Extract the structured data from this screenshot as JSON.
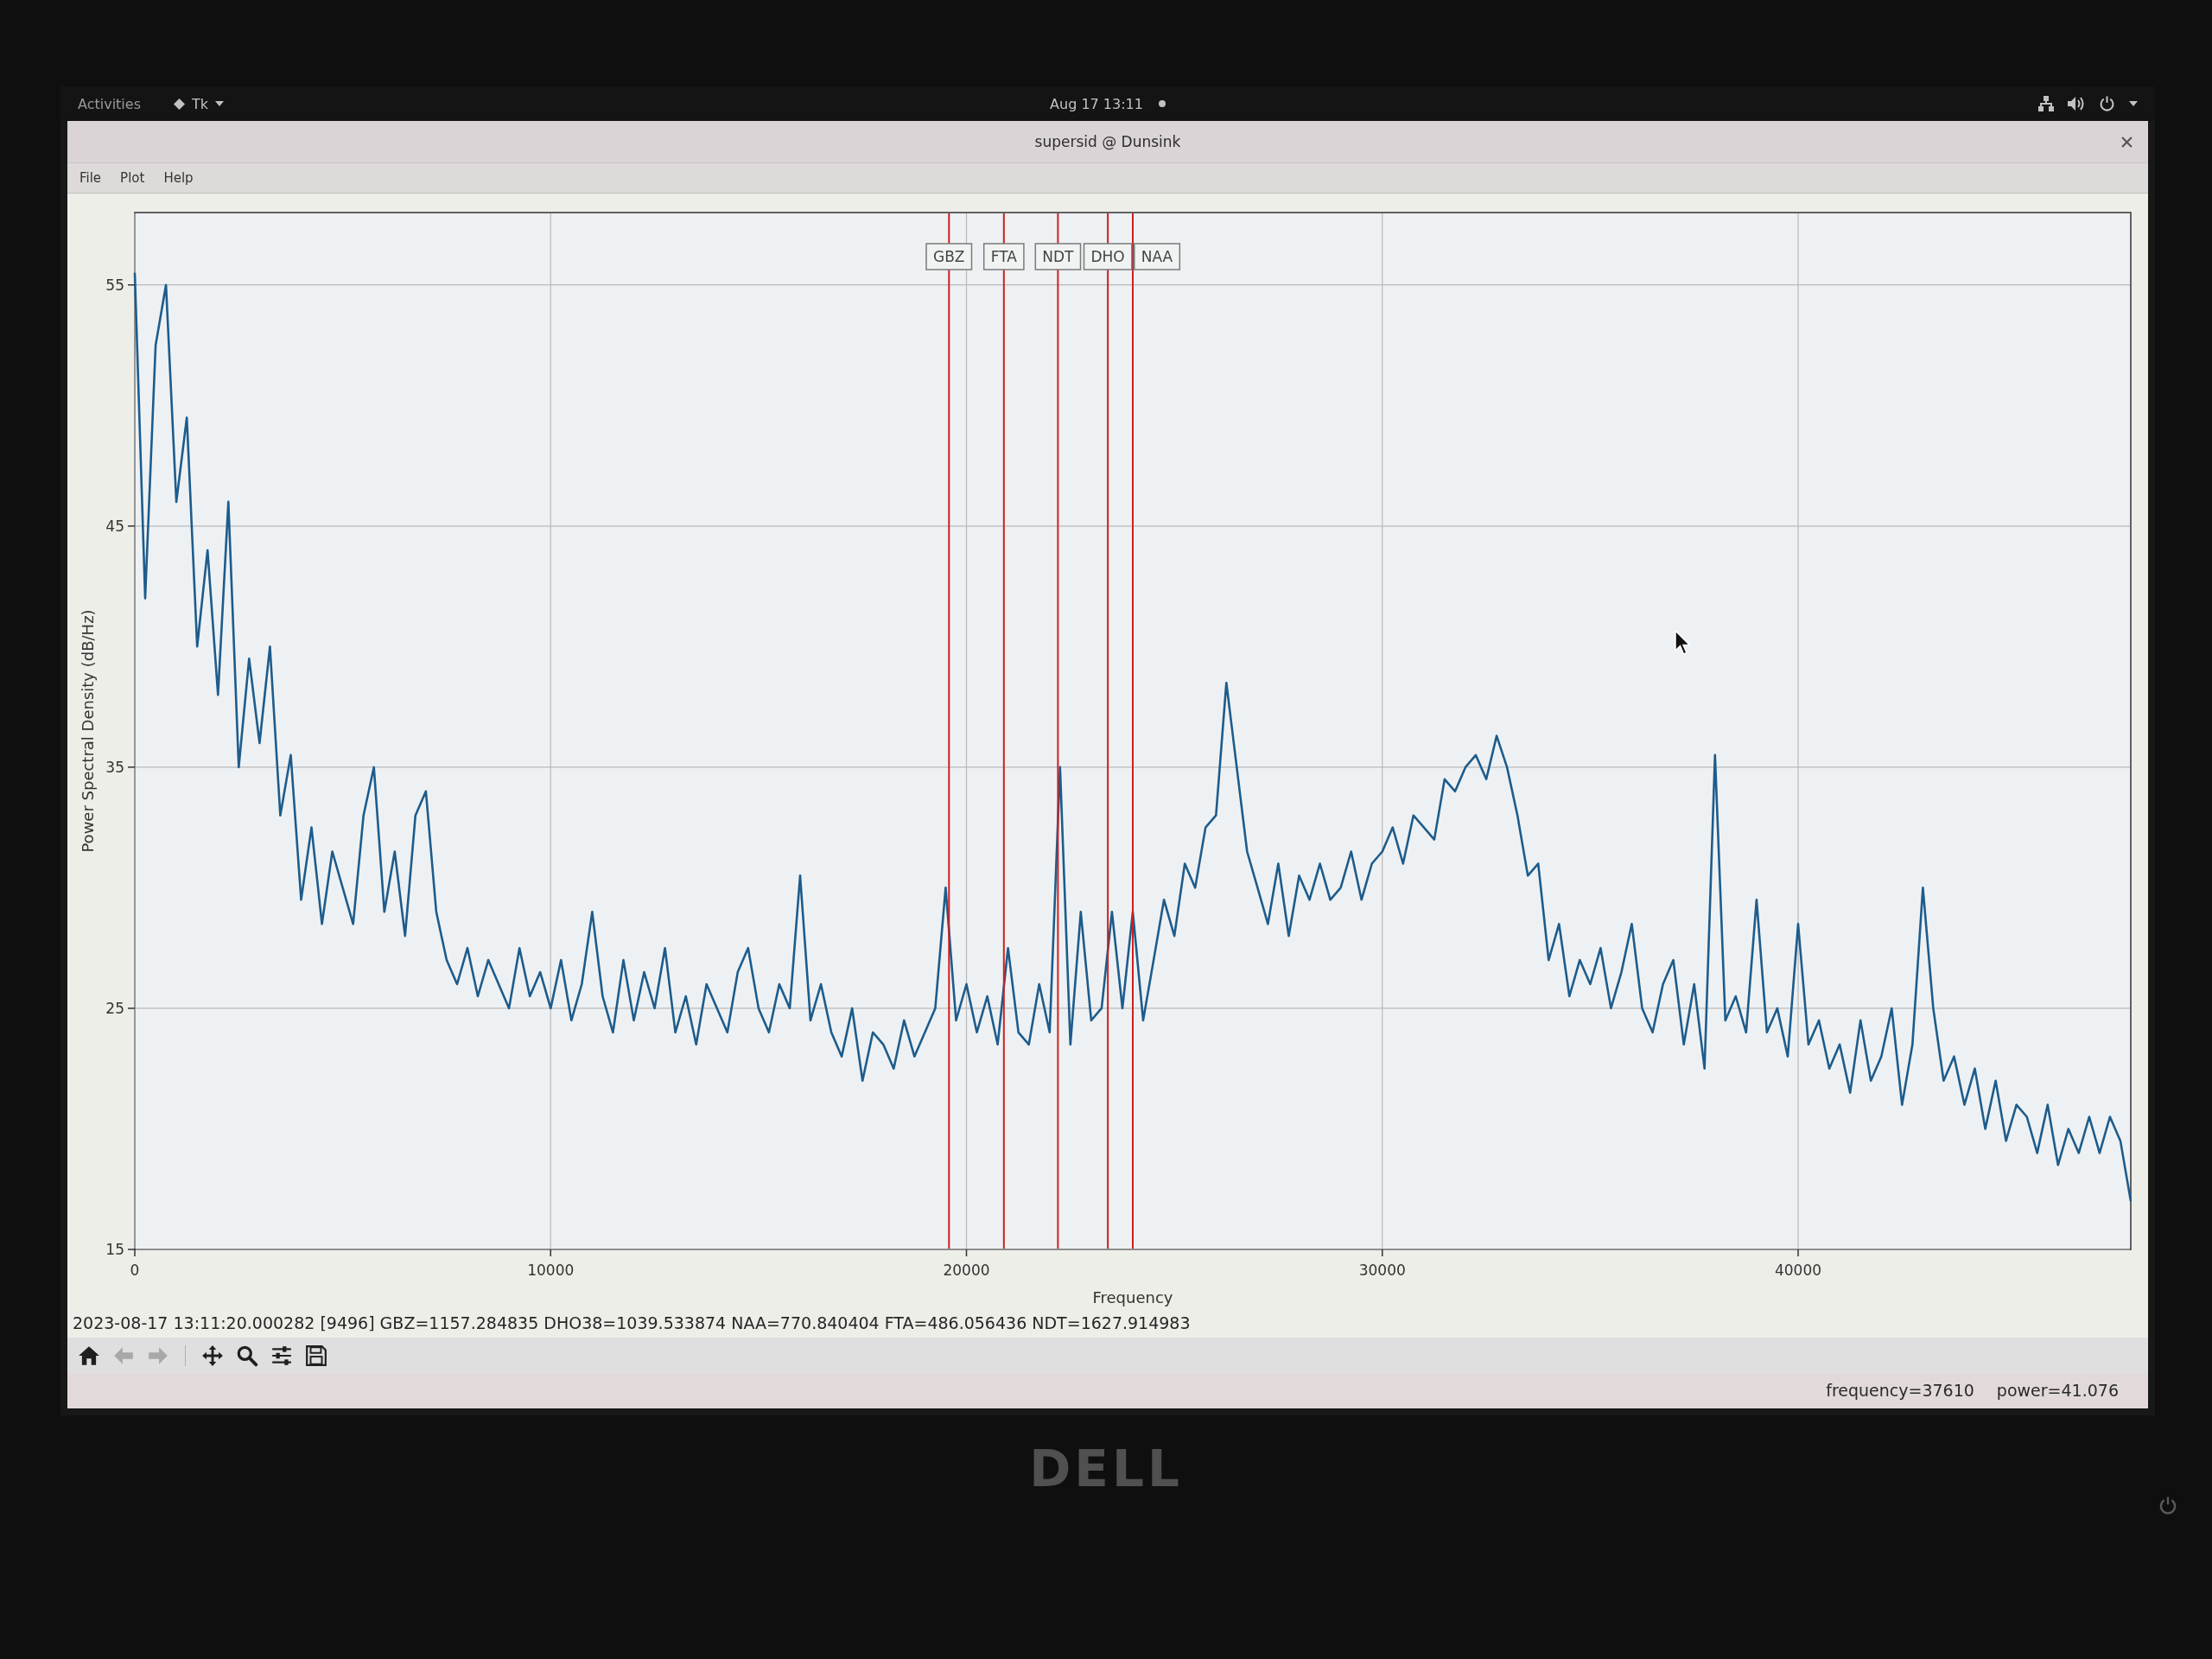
{
  "top_bar": {
    "activities": "Activities",
    "app_menu": "Tk",
    "clock": "Aug 17 13:11"
  },
  "window": {
    "title": "supersid @ Dunsink"
  },
  "menu": [
    "File",
    "Plot",
    "Help"
  ],
  "plot": {
    "chart_data": {
      "type": "line",
      "xlabel": "Frequency",
      "ylabel": "Power Spectral Density (dB/Hz)",
      "x": [
        0,
        250,
        500,
        750,
        1000,
        1250,
        1500,
        1750,
        2000,
        2250,
        2500,
        2750,
        3000,
        3250,
        3500,
        3750,
        4000,
        4250,
        4500,
        4750,
        5000,
        5250,
        5500,
        5750,
        6000,
        6250,
        6500,
        6750,
        7000,
        7250,
        7500,
        7750,
        8000,
        8250,
        8500,
        8750,
        9000,
        9250,
        9500,
        9750,
        10000,
        10250,
        10500,
        10750,
        11000,
        11250,
        11500,
        11750,
        12000,
        12250,
        12500,
        12750,
        13000,
        13250,
        13500,
        13750,
        14000,
        14250,
        14500,
        14750,
        15000,
        15250,
        15500,
        15750,
        16000,
        16250,
        16500,
        16750,
        17000,
        17250,
        17500,
        17750,
        18000,
        18250,
        18500,
        18750,
        19000,
        19250,
        19500,
        19750,
        20000,
        20250,
        20500,
        20750,
        21000,
        21250,
        21500,
        21750,
        22000,
        22250,
        22500,
        22750,
        23000,
        23250,
        23500,
        23750,
        24000,
        24250,
        24500,
        24750,
        25000,
        25250,
        25500,
        25750,
        26000,
        26250,
        26500,
        26750,
        27000,
        27250,
        27500,
        27750,
        28000,
        28250,
        28500,
        28750,
        29000,
        29250,
        29500,
        29750,
        30000,
        30250,
        30500,
        30750,
        31000,
        31250,
        31500,
        31750,
        32000,
        32250,
        32500,
        32750,
        33000,
        33250,
        33500,
        33750,
        34000,
        34250,
        34500,
        34750,
        35000,
        35250,
        35500,
        35750,
        36000,
        36250,
        36500,
        36750,
        37000,
        37250,
        37500,
        37750,
        38000,
        38250,
        38500,
        38750,
        39000,
        39250,
        39500,
        39750,
        40000,
        40250,
        40500,
        40750,
        41000,
        41250,
        41500,
        41750,
        42000,
        42250,
        42500,
        42750,
        43000,
        43250,
        43500,
        43750,
        44000,
        44250,
        44500,
        44750,
        45000,
        45250,
        45500,
        45750,
        46000,
        46250,
        46500,
        46750,
        47000,
        47250,
        47500,
        47750,
        48000
      ],
      "series": [
        {
          "color": "#1d5c8c",
          "values": [
            55.5,
            42,
            52.5,
            55,
            46,
            49.5,
            40,
            44,
            38,
            46,
            35,
            39.5,
            36,
            40,
            33,
            35.5,
            29.5,
            32.5,
            28.5,
            31.5,
            30,
            28.5,
            33,
            35,
            29,
            31.5,
            28,
            33,
            34,
            29,
            27,
            26,
            27.5,
            25.5,
            27,
            26,
            25,
            27.5,
            25.5,
            26.5,
            25,
            27,
            24.5,
            26,
            29,
            25.5,
            24,
            27,
            24.5,
            26.5,
            25,
            27.5,
            24,
            25.5,
            23.5,
            26,
            25,
            24,
            26.5,
            27.5,
            25,
            24,
            26,
            25,
            30.5,
            24.5,
            26,
            24,
            23,
            25,
            22,
            24,
            23.5,
            22.5,
            24.5,
            23,
            24,
            25,
            30,
            24.5,
            26,
            24,
            25.5,
            23.5,
            27.5,
            24,
            23.5,
            26,
            24,
            35,
            23.5,
            29,
            24.5,
            25,
            29,
            25,
            29,
            24.5,
            27,
            29.5,
            28,
            31,
            30,
            32.5,
            33,
            38.5,
            35,
            31.5,
            30,
            28.5,
            31,
            28,
            30.5,
            29.5,
            31,
            29.5,
            30,
            31.5,
            29.5,
            31,
            31.5,
            32.5,
            31,
            33,
            32.5,
            32,
            34.5,
            34,
            35,
            35.5,
            34.5,
            36.3,
            35,
            33,
            30.5,
            31,
            27,
            28.5,
            25.5,
            27,
            26,
            27.5,
            25,
            26.5,
            28.5,
            25,
            24,
            26,
            27,
            23.5,
            26,
            22.5,
            35.5,
            24.5,
            25.5,
            24,
            29.5,
            24,
            25,
            23,
            28.5,
            23.5,
            24.5,
            22.5,
            23.5,
            21.5,
            24.5,
            22,
            23,
            25,
            21,
            23.5,
            30,
            25,
            22,
            23,
            21,
            22.5,
            20,
            22,
            19.5,
            21,
            20.5,
            19,
            21,
            18.5,
            20,
            19,
            20.5,
            19,
            20.5,
            19.5,
            17
          ]
        }
      ],
      "xlim": [
        0,
        48000
      ],
      "ylim": [
        15,
        58
      ],
      "xticks": [
        0,
        10000,
        20000,
        30000,
        40000
      ],
      "yticks": [
        15,
        25,
        35,
        45,
        55
      ],
      "grid": true,
      "ref_lines": [
        {
          "axis": "x",
          "value": 19580,
          "label": "GBZ",
          "color": "#d01f1f"
        },
        {
          "axis": "x",
          "value": 20900,
          "label": "FTA",
          "color": "#d01f1f"
        },
        {
          "axis": "x",
          "value": 22200,
          "label": "NDT",
          "color": "#d01f1f"
        },
        {
          "axis": "x",
          "value": 23400,
          "label": "DHO",
          "color": "#d01f1f"
        },
        {
          "axis": "x",
          "value": 24000,
          "label": "NAA",
          "color": "#d01f1f"
        }
      ]
    }
  },
  "status_text": "2023-08-17 13:11:20.000282 [9496] GBZ=1157.284835 DHO38=1039.533874 NAA=770.840404 FTA=486.056436 NDT=1627.914983",
  "toolbar": [
    {
      "kind": "home",
      "disabled": false
    },
    {
      "kind": "back",
      "disabled": true
    },
    {
      "kind": "forward",
      "disabled": true
    },
    {
      "kind": "pan",
      "disabled": false
    },
    {
      "kind": "zoom",
      "disabled": false
    },
    {
      "kind": "configure",
      "disabled": false
    },
    {
      "kind": "save",
      "disabled": false
    }
  ],
  "coordinates": [
    "frequency=37610",
    "power=41.076"
  ],
  "bezel": {
    "logo": "DELL"
  }
}
